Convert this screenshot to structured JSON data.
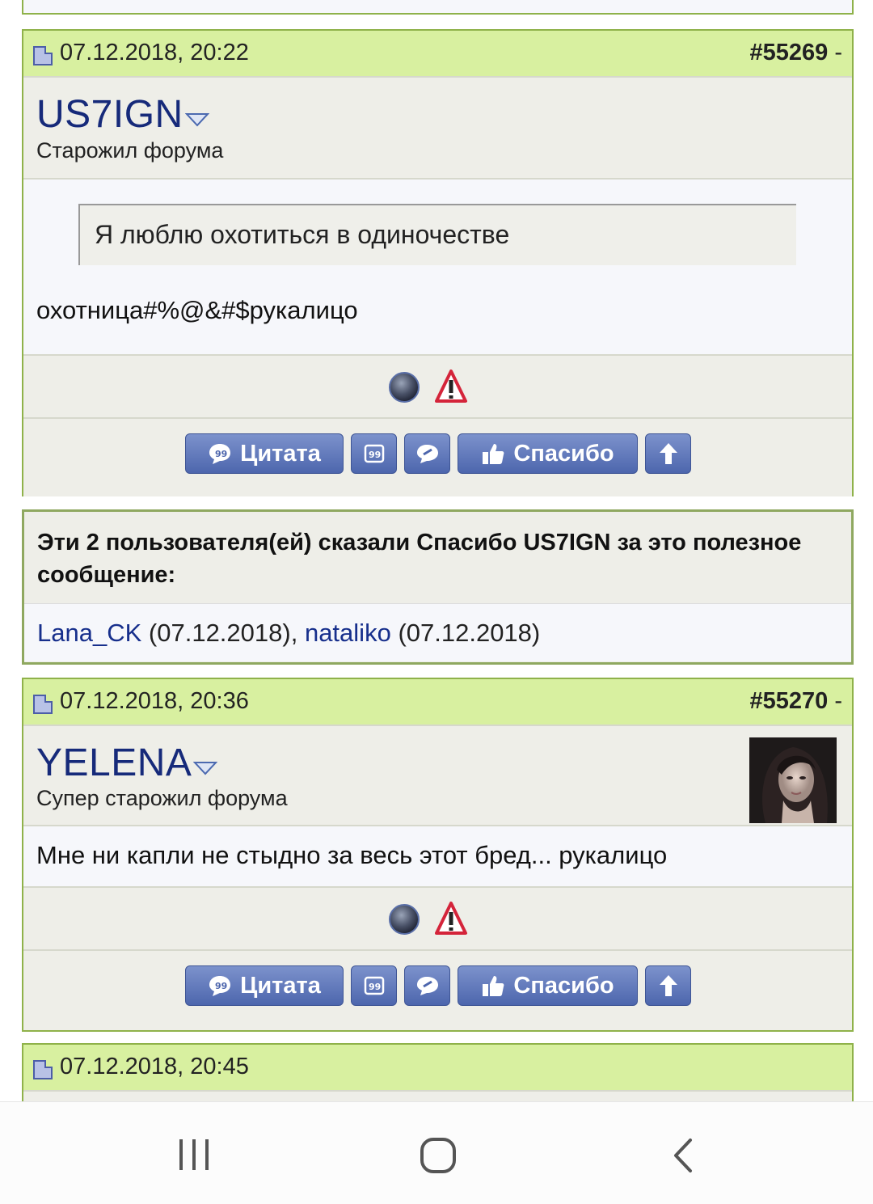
{
  "posts": [
    {
      "date": "07.12.2018, 20:22",
      "number": "#55269",
      "number_suffix": " -",
      "username": "US7IGN",
      "user_title": "Старожил форума",
      "quote": "Я люблю охотиться в одиночестве",
      "text": "охотница#%@&#$рукалицо"
    },
    {
      "date": "07.12.2018, 20:36",
      "number": "#55270",
      "number_suffix": " -",
      "username": "YELENA",
      "user_title": "Супер старожил форума",
      "text": "Мне ни капли не стыдно за весь этот бред... рукалицо"
    },
    {
      "date": "07.12.2018, 20:45"
    }
  ],
  "buttons": {
    "quote_label": "Цитата",
    "thanks_label": "Спасибо"
  },
  "thanks_box": {
    "title": "Эти 2 пользователя(ей) сказали Спасибо US7IGN за это полезное сообщение:",
    "users": [
      {
        "name": "Lana_CK",
        "date": "(07.12.2018)"
      },
      {
        "name": "nataliko",
        "date": "(07.12.2018)"
      }
    ],
    "separator": ", "
  },
  "icons": {
    "post_icon": "page-icon",
    "status": "ball-icon",
    "report": "warning-icon",
    "quote": "quote-bubble-icon",
    "multiquote": "multiquote-icon",
    "reply": "quick-reply-icon",
    "thanks": "thumbs-up-icon",
    "top": "arrow-up-icon",
    "nav": [
      "recent-apps-icon",
      "home-icon",
      "back-icon"
    ]
  },
  "colors": {
    "header_bg": "#d8f0a0",
    "border": "#8fb24a",
    "username": "#162a7a",
    "button": "#5a72b8"
  }
}
